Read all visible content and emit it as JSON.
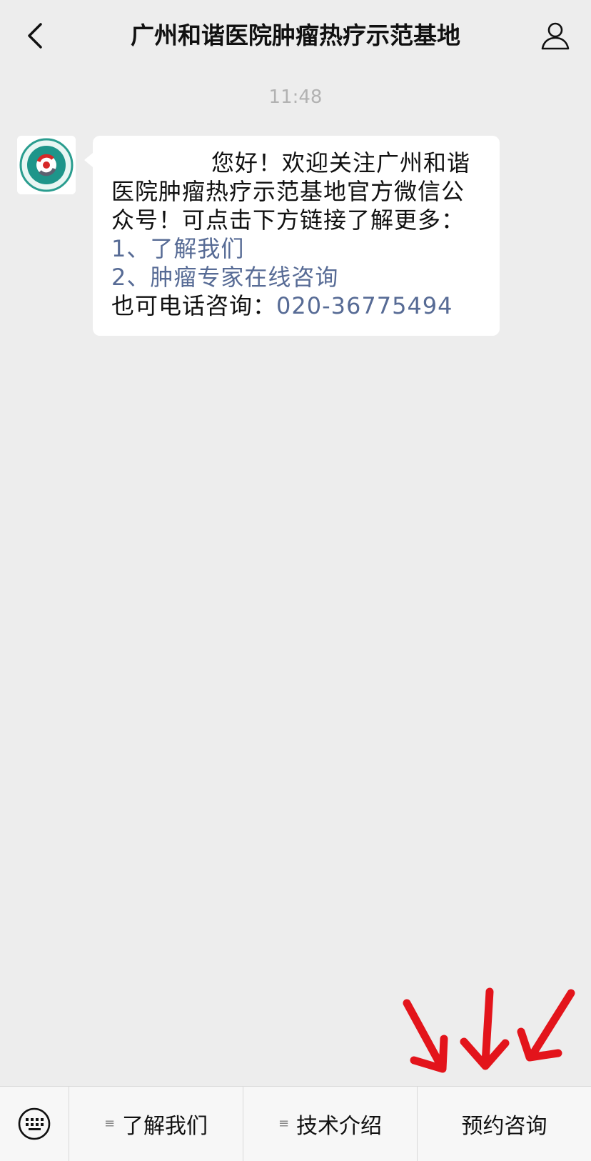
{
  "header": {
    "title": "广州和谐医院肿瘤热疗示范基地",
    "back_icon": "chevron-left-icon",
    "profile_icon": "person-icon"
  },
  "chat": {
    "timestamp": "11:48",
    "message": {
      "greeting": "您好！欢迎关注广州和谐医院肿瘤热疗示范基地官方微信公众号！可点击下方链接了解更多：",
      "link1": "1、了解我们",
      "link2": "2、肿瘤专家在线咨询",
      "phone_prefix": "也可电话咨询：",
      "phone": "020-36775494"
    }
  },
  "menu": {
    "keyboard_icon": "keyboard-icon",
    "items": [
      {
        "label": "了解我们",
        "has_submenu": true
      },
      {
        "label": "技术介绍",
        "has_submenu": true
      },
      {
        "label": "预约咨询",
        "has_submenu": false
      }
    ]
  },
  "colors": {
    "background": "#ededed",
    "link": "#576b95",
    "annotation_arrows": "#e3141b"
  }
}
